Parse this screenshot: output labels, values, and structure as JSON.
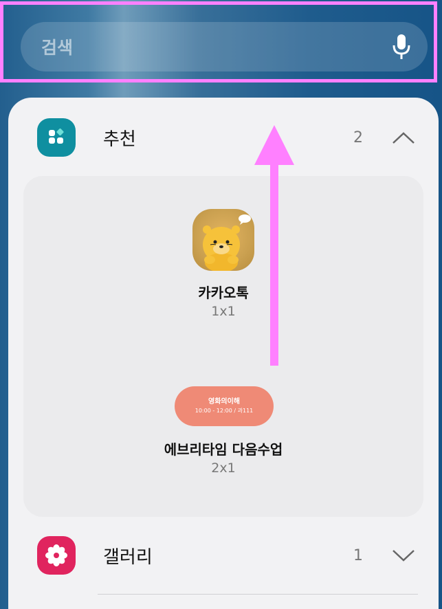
{
  "search": {
    "placeholder": "검색",
    "mic_icon": "microphone-icon"
  },
  "sections": [
    {
      "title": "추천",
      "count": "2",
      "icon": "grid-apps-icon",
      "icon_color": "#0f8fa0",
      "expanded": true,
      "widgets": [
        {
          "name": "카카오톡",
          "size": "1x1",
          "icon": "kakaotalk-icon"
        },
        {
          "name": "에브리타임 다음수업",
          "size": "2x1",
          "preview": {
            "title": "영화의이해",
            "subtitle": "10:00 - 12:00 / 과111"
          }
        }
      ]
    },
    {
      "title": "갤러리",
      "count": "1",
      "icon": "gallery-flower-icon",
      "icon_color": "#e0245e",
      "expanded": false
    }
  ],
  "colors": {
    "highlight": "#ff80ff",
    "panel_bg": "#f2f2f4",
    "widget_box_bg": "#ebebed",
    "timetable_pill": "#ef8a76"
  }
}
